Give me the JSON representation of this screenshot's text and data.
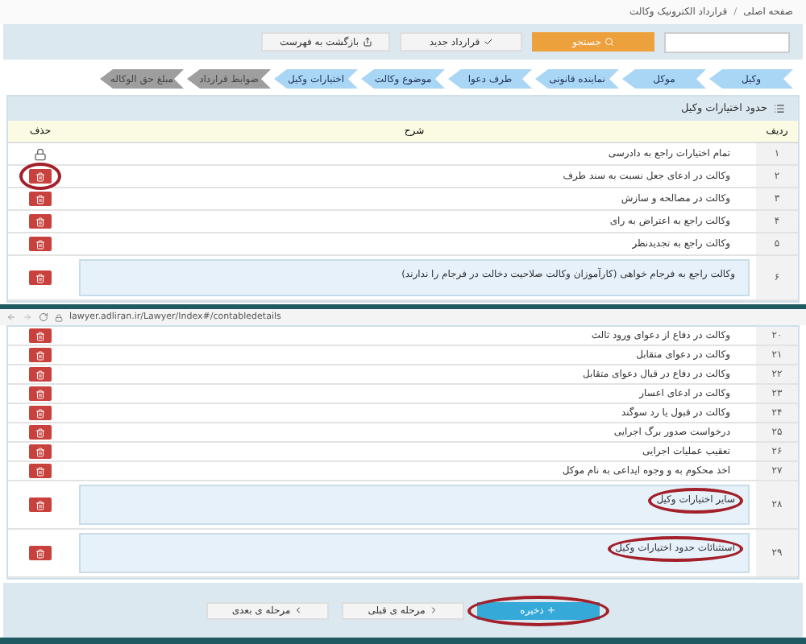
{
  "breadcrumb": [
    "صفحه اصلی",
    "قرارداد الکترونیک وکالت"
  ],
  "breadcrumb_separator": "/",
  "toolbar": {
    "search_button": "جستجو",
    "new_button": "قرارداد جدید",
    "back_button": "بازگشت به فهرست"
  },
  "steps": [
    {
      "label": "وکیل",
      "disabled": false
    },
    {
      "label": "موکل",
      "disabled": false
    },
    {
      "label": "نماینده قانونی",
      "disabled": false
    },
    {
      "label": "طرف دعوا",
      "disabled": false
    },
    {
      "label": "موضوع وکالت",
      "disabled": false
    },
    {
      "label": "اختیارات وکیل",
      "disabled": false
    },
    {
      "label": "ضوابط قرارداد",
      "disabled": true
    },
    {
      "label": "مبلغ حق الوکاله",
      "disabled": true
    }
  ],
  "panel": {
    "title": "حدود اختیارات وکیل",
    "columns": [
      "ردیف",
      "شرح",
      "حذف"
    ],
    "rows": [
      {
        "kind": "text",
        "number": "۱",
        "text": "تمام اختیارات راجع به دادرسی",
        "deletable": false,
        "circled": false
      },
      {
        "kind": "text",
        "number": "۲",
        "text": "وکالت در ادعای جعل نسبت به سند طرف",
        "deletable": true,
        "circled": true
      },
      {
        "kind": "text",
        "number": "۳",
        "text": "وکالت در مصالحه و سازش",
        "deletable": true,
        "circled": false
      },
      {
        "kind": "text",
        "number": "۴",
        "text": "وکالت راجع به اعتراض به رای",
        "deletable": true,
        "circled": false
      },
      {
        "kind": "text",
        "number": "۵",
        "text": "وکالت راجع به تجدیدنظر",
        "deletable": true,
        "circled": false
      },
      {
        "kind": "textarea",
        "number": "۶",
        "text": "وکالت راجع به فرجام خواهی (کارآموزان وکالت صلاحیت دخالت در فرجام را ندارند)",
        "deletable": true,
        "circled": false
      }
    ]
  },
  "second_screenshot": {
    "url": "lawyer.adliran.ir/Lawyer/Index#/contabledetails",
    "rows": [
      {
        "kind": "text",
        "number": "۲۰",
        "text": "وکالت در دفاع از دعوای ورود ثالث",
        "deletable": true,
        "circled": false
      },
      {
        "kind": "text",
        "number": "۲۱",
        "text": "وکالت در دعوای متقابل",
        "deletable": true,
        "circled": false
      },
      {
        "kind": "text",
        "number": "۲۲",
        "text": "وکالت در دفاع در قبال دعوای متقابل",
        "deletable": true,
        "circled": false
      },
      {
        "kind": "text",
        "number": "۲۳",
        "text": "وکالت در ادعای اعسار",
        "deletable": true,
        "circled": false
      },
      {
        "kind": "text",
        "number": "۲۴",
        "text": "وکالت در قبول یا رد سوگند",
        "deletable": true,
        "circled": false
      },
      {
        "kind": "text",
        "number": "۲۵",
        "text": "درخواست صدور برگ اجرایی",
        "deletable": true,
        "circled": false
      },
      {
        "kind": "text",
        "number": "۲۶",
        "text": "تعقیب عملیات اجرایی",
        "deletable": true,
        "circled": false
      },
      {
        "kind": "text",
        "number": "۲۷",
        "text": "اخذ محکوم به و وجوه ایداعی به نام موکل",
        "deletable": true,
        "circled": false
      },
      {
        "kind": "textarea",
        "number": "۲۸",
        "text": "سایر اختیارات وکیل",
        "deletable": true,
        "circled": true
      },
      {
        "kind": "textarea",
        "number": "۲۹",
        "text": "استثنائات حدود اختیارات وکیل",
        "deletable": true,
        "circled": true
      }
    ],
    "buttons": [
      {
        "kind": "save",
        "label": "ذخیره",
        "circled": true
      },
      {
        "kind": "prev",
        "label": "مرحله ی قبلی",
        "circled": false
      },
      {
        "kind": "next",
        "label": "مرحله ی بعدی",
        "circled": false
      }
    ]
  }
}
